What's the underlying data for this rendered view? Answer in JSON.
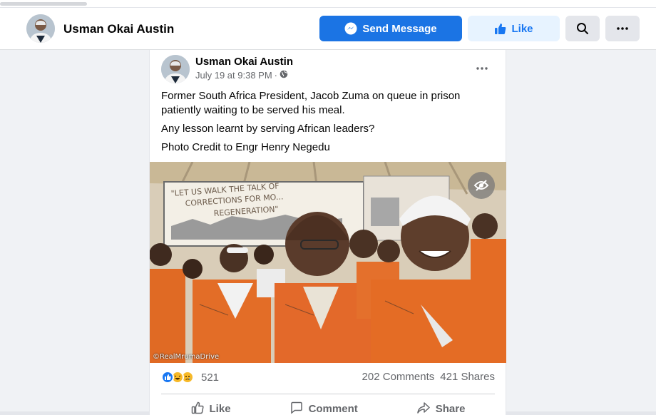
{
  "page": {
    "name": "Usman Okai Austin",
    "buttons": {
      "send_message": "Send Message",
      "like": "Like",
      "search_icon": "search-icon",
      "more_icon": "more-horizontal-icon"
    }
  },
  "post": {
    "author": "Usman Okai Austin",
    "timestamp": "July 19 at 9:38 PM",
    "separator": "·",
    "audience_icon": "globe-icon",
    "paragraphs": [
      "Former South Africa President, Jacob Zuma on queue in prison patiently waiting to be served his meal.",
      "Any lesson learnt by serving African leaders?",
      "Photo Credit to Engr Henry Negedu"
    ],
    "image": {
      "banner_text": "\"LET US WALK THE TALK OF CORRECTIONS FOR MO... REGENERATION\"",
      "watermark": "©RealMrumaDrive",
      "hide_icon": "eye-off-icon"
    },
    "reactions": {
      "icons": [
        "like-reaction-icon",
        "haha-reaction-icon",
        "sad-reaction-icon"
      ],
      "count": "521"
    },
    "comments": "202 Comments",
    "shares": "421 Shares",
    "actions": {
      "like": "Like",
      "comment": "Comment",
      "share": "Share"
    }
  },
  "colors": {
    "brand_blue": "#1877f2",
    "send_button": "#1b74e4",
    "background": "#f0f2f5",
    "secondary_text": "#65676b"
  }
}
